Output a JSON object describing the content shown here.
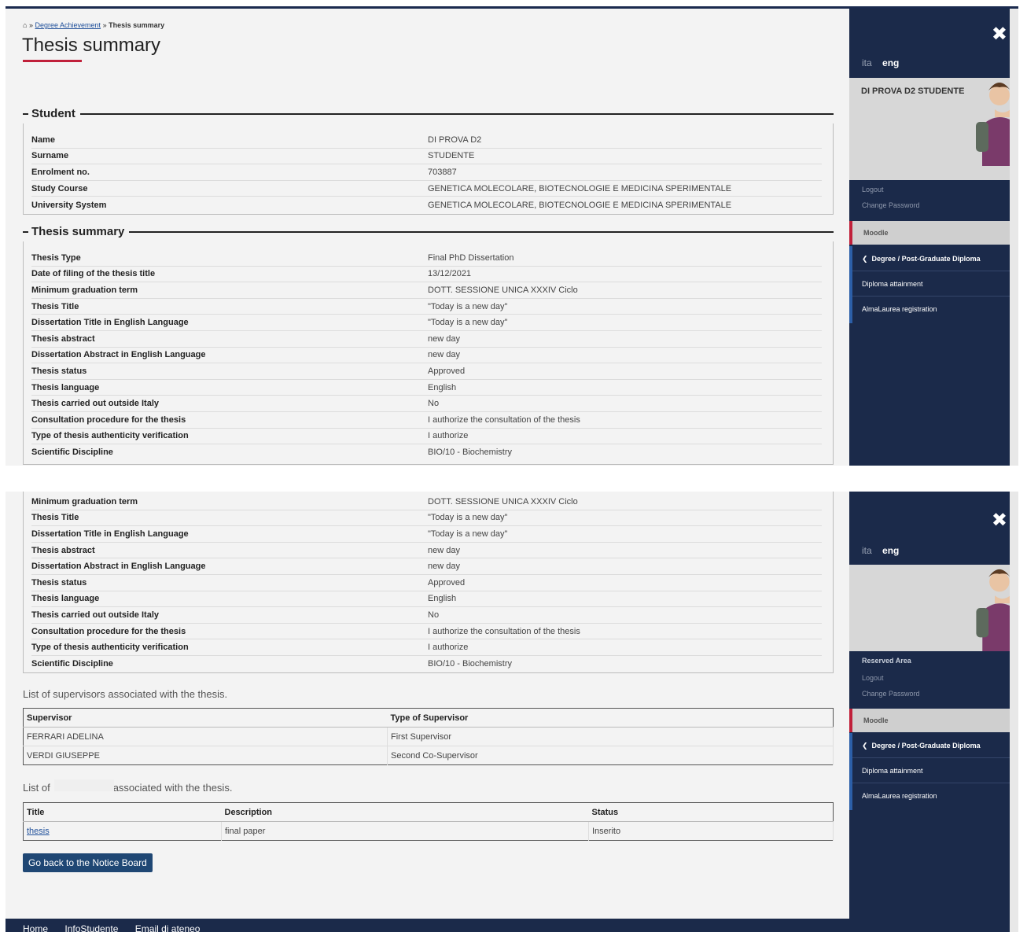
{
  "breadcrumb": {
    "link": "Degree Achievement",
    "sep": "»",
    "current": "Thesis summary"
  },
  "page": {
    "title": "Thesis summary"
  },
  "student": {
    "legend": "Student",
    "rows": [
      {
        "label": "Name",
        "value": "DI PROVA D2"
      },
      {
        "label": "Surname",
        "value": "STUDENTE"
      },
      {
        "label": "Enrolment no.",
        "value": "703887"
      },
      {
        "label": "Study Course",
        "value": "GENETICA MOLECOLARE, BIOTECNOLOGIE E MEDICINA SPERIMENTALE"
      },
      {
        "label": "University System",
        "value": "GENETICA MOLECOLARE, BIOTECNOLOGIE E MEDICINA SPERIMENTALE"
      }
    ]
  },
  "thesis": {
    "legend": "Thesis summary",
    "rows": [
      {
        "label": "Thesis Type",
        "value": "Final PhD Dissertation"
      },
      {
        "label": "Date of filing of the thesis title",
        "value": "13/12/2021"
      },
      {
        "label": "Minimum graduation term",
        "value": "DOTT. SESSIONE UNICA XXXIV Ciclo"
      },
      {
        "label": "Thesis Title",
        "value": "\"Today is a new day\""
      },
      {
        "label": "Dissertation Title in English Language",
        "value": "\"Today is a new day\""
      },
      {
        "label": "Thesis abstract",
        "value": "new day"
      },
      {
        "label": "Dissertation Abstract in English Language",
        "value": "new day"
      },
      {
        "label": "Thesis status",
        "value": "Approved"
      },
      {
        "label": "Thesis language",
        "value": "English"
      },
      {
        "label": "Thesis carried out outside Italy",
        "value": "No"
      },
      {
        "label": "Consultation procedure for the thesis",
        "value": "I authorize the consultation of the thesis"
      },
      {
        "label": "Type of thesis authenticity verification",
        "value": "I authorize"
      },
      {
        "label": "Scientific Discipline",
        "value": "BIO/10 - Biochemistry"
      }
    ]
  },
  "supervisors": {
    "caption": "List of supervisors associated with the thesis.",
    "headers": [
      "Supervisor",
      "Type of Supervisor"
    ],
    "rows": [
      [
        "FERRARI ADELINA",
        "First Supervisor"
      ],
      [
        "VERDI GIUSEPPE",
        "Second Co-Supervisor"
      ]
    ]
  },
  "attachments": {
    "caption_start": "List of",
    "caption_end": "associated with the thesis.",
    "headers": [
      "Title",
      "Description",
      "Status"
    ],
    "rows": [
      [
        "thesis",
        "final paper",
        "Inserito"
      ]
    ]
  },
  "back_button": "Go back to the Notice Board",
  "footer": [
    "Home",
    "InfoStudente",
    "Email di ateneo"
  ],
  "sidebar": {
    "lang_ita": "ita",
    "lang_eng": "eng",
    "user_name": "DI PROVA D2 STUDENTE",
    "reserved_area": "Reserved Area",
    "logout": "Logout",
    "change_password": "Change Password",
    "moodle": "Moodle",
    "menu_head": "Degree / Post-Graduate Diploma",
    "menu_items": [
      "Diploma attainment",
      "AlmaLaurea registration"
    ]
  },
  "colors": {
    "navy": "#1b2a4a",
    "accent_red": "#c0203a",
    "button": "#1f4774",
    "link": "#1f4f9a"
  }
}
